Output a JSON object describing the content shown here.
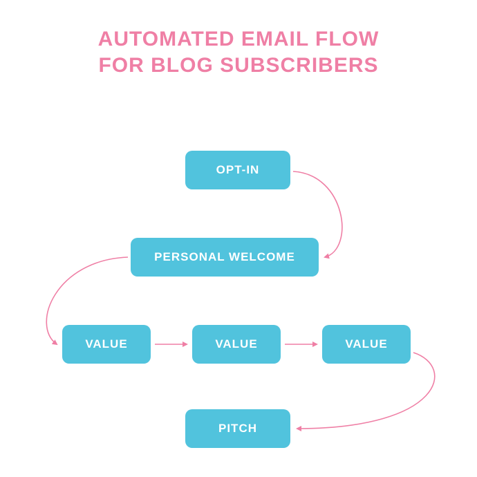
{
  "title_line1": "AUTOMATED EMAIL FLOW",
  "title_line2": "FOR BLOG SUBSCRIBERS",
  "nodes": {
    "optin": "OPT-IN",
    "welcome": "PERSONAL WELCOME",
    "value1": "VALUE",
    "value2": "VALUE",
    "value3": "VALUE",
    "pitch": "PITCH"
  },
  "colors": {
    "node_bg": "#51c3dd",
    "title": "#ef7fa5",
    "arrow": "#ef7fa5"
  }
}
